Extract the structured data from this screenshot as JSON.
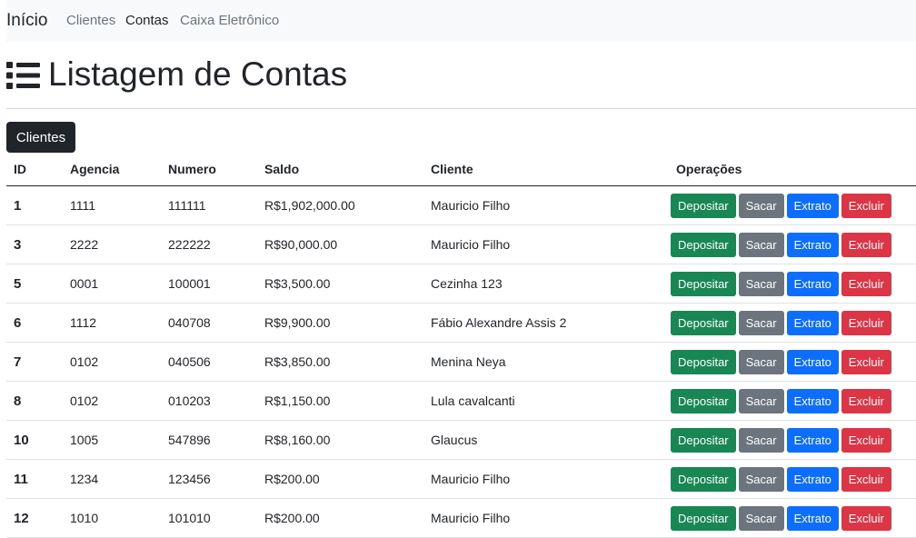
{
  "navbar": {
    "brand": "Início",
    "links": [
      "Clientes",
      "Contas",
      "Caixa Eletrônico"
    ],
    "active": "Contas"
  },
  "page": {
    "icon": "list-icon",
    "title": "Listagem de Contas",
    "clientes_button": "Clientes"
  },
  "table": {
    "headers": [
      "ID",
      "Agencia",
      "Numero",
      "Saldo",
      "Cliente",
      "Operações"
    ],
    "operations": [
      "Depositar",
      "Sacar",
      "Extrato",
      "Excluir"
    ],
    "rows": [
      {
        "id": "1",
        "agencia": "1111",
        "numero": "111111",
        "saldo": "R$1,902,000.00",
        "cliente": "Mauricio Filho"
      },
      {
        "id": "3",
        "agencia": "2222",
        "numero": "222222",
        "saldo": "R$90,000.00",
        "cliente": "Mauricio Filho"
      },
      {
        "id": "5",
        "agencia": "0001",
        "numero": "100001",
        "saldo": "R$3,500.00",
        "cliente": "Cezinha 123"
      },
      {
        "id": "6",
        "agencia": "1112",
        "numero": "040708",
        "saldo": "R$9,900.00",
        "cliente": "Fábio Alexandre Assis 2"
      },
      {
        "id": "7",
        "agencia": "0102",
        "numero": "040506",
        "saldo": "R$3,850.00",
        "cliente": "Menina Neya"
      },
      {
        "id": "8",
        "agencia": "0102",
        "numero": "010203",
        "saldo": "R$1,150.00",
        "cliente": "Lula cavalcanti"
      },
      {
        "id": "10",
        "agencia": "1005",
        "numero": "547896",
        "saldo": "R$8,160.00",
        "cliente": "Glaucus"
      },
      {
        "id": "11",
        "agencia": "1234",
        "numero": "123456",
        "saldo": "R$200.00",
        "cliente": "Mauricio Filho"
      },
      {
        "id": "12",
        "agencia": "1010",
        "numero": "101010",
        "saldo": "R$200.00",
        "cliente": "Mauricio Filho"
      }
    ]
  },
  "colors": {
    "depositar": "#198754",
    "sacar": "#6c757d",
    "extrato": "#0d6efd",
    "excluir": "#dc3545",
    "dark": "#212529",
    "navbar_bg": "#f8f9fa"
  }
}
